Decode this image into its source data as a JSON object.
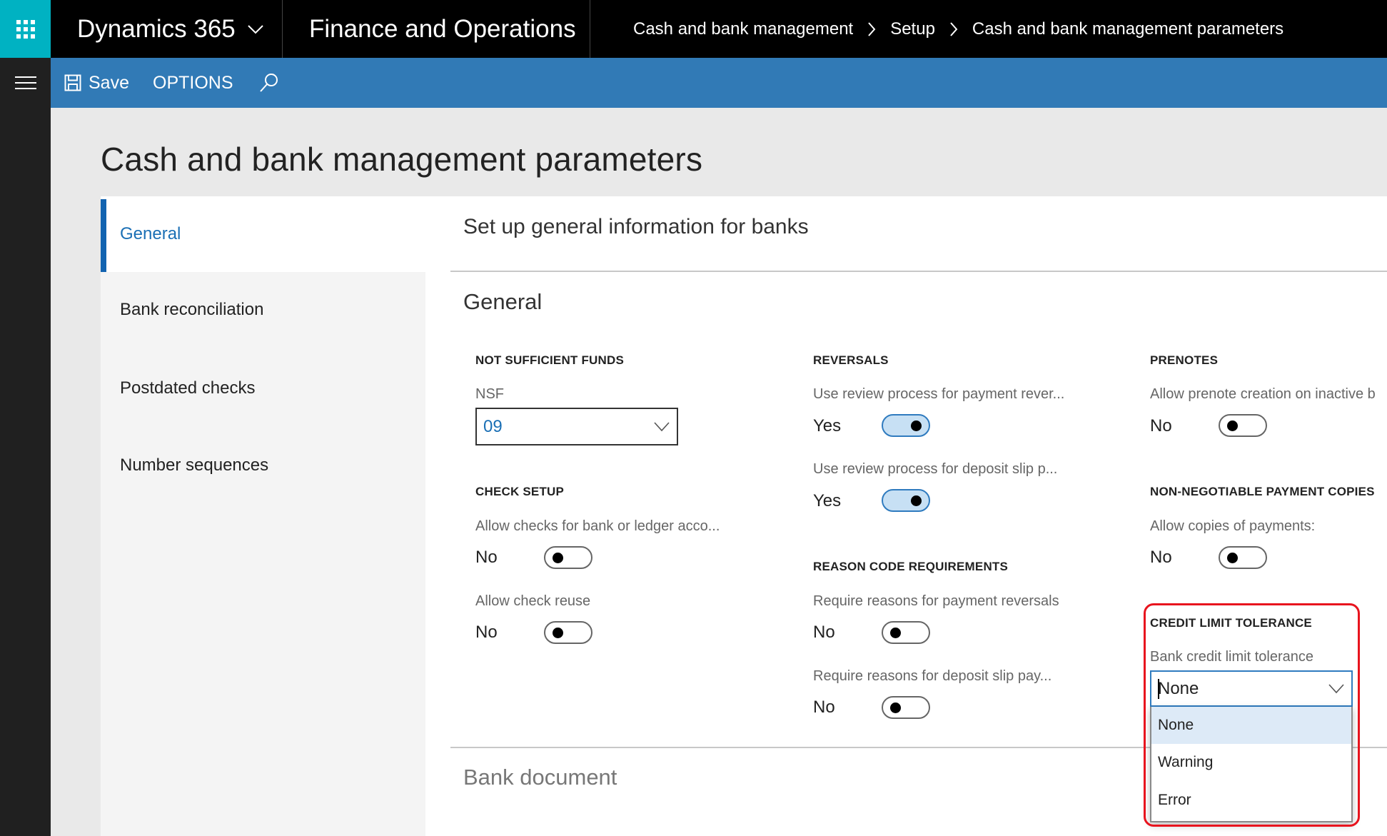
{
  "header": {
    "app_launcher_icon": "waffle-icon",
    "product": "Dynamics 365",
    "product_chevron_icon": "chevron-down-icon",
    "module": "Finance and Operations",
    "breadcrumb": [
      "Cash and bank management",
      "Setup",
      "Cash and bank management parameters"
    ],
    "breadcrumb_separator_icon": "chevron-right-icon"
  },
  "toolbar": {
    "menu_icon": "hamburger-icon",
    "save_icon": "save-icon",
    "save_label": "Save",
    "options_label": "OPTIONS",
    "search_icon": "search-icon"
  },
  "page": {
    "title": "Cash and bank management parameters"
  },
  "nav": {
    "items": [
      {
        "label": "General",
        "active": true
      },
      {
        "label": "Bank reconciliation",
        "active": false
      },
      {
        "label": "Postdated checks",
        "active": false
      },
      {
        "label": "Number sequences",
        "active": false
      }
    ]
  },
  "content": {
    "heading": "Set up general information for banks",
    "section_general": "General",
    "section_bank_document": "Bank document",
    "not_sufficient_funds": {
      "title": "NOT SUFFICIENT FUNDS",
      "nsf_label": "NSF",
      "nsf_value": "09"
    },
    "check_setup": {
      "title": "CHECK SETUP",
      "allow_checks_label": "Allow checks for bank or ledger acco...",
      "allow_checks_value": "No",
      "allow_checks_on": false,
      "allow_reuse_label": "Allow check reuse",
      "allow_reuse_value": "No",
      "allow_reuse_on": false
    },
    "reversals": {
      "title": "REVERSALS",
      "payment_label": "Use review process for payment rever...",
      "payment_value": "Yes",
      "payment_on": true,
      "deposit_label": "Use review process for deposit slip p...",
      "deposit_value": "Yes",
      "deposit_on": true
    },
    "reason_codes": {
      "title": "REASON CODE REQUIREMENTS",
      "payment_label": "Require reasons for payment reversals",
      "payment_value": "No",
      "payment_on": false,
      "deposit_label": "Require reasons for deposit slip pay...",
      "deposit_value": "No",
      "deposit_on": false
    },
    "prenotes": {
      "title": "PRENOTES",
      "allow_label": "Allow prenote creation on inactive b",
      "allow_value": "No",
      "allow_on": false
    },
    "non_negotiable": {
      "title": "NON-NEGOTIABLE PAYMENT COPIES",
      "allow_label": "Allow copies of payments:",
      "allow_value": "No",
      "allow_on": false
    },
    "credit_limit": {
      "title": "CREDIT LIMIT TOLERANCE",
      "label": "Bank credit limit tolerance",
      "value": "None",
      "options": [
        "None",
        "Warning",
        "Error"
      ],
      "selected_index": 0,
      "highlight_color": "#e8141e"
    }
  },
  "colors": {
    "launcher": "#00b2c2",
    "toolbar": "#317ab6",
    "accent": "#1a6fb5",
    "toggle_on_fill": "#c7e0f4"
  }
}
